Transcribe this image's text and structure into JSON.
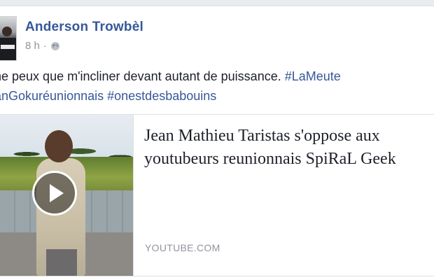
{
  "post": {
    "author": "Anderson Trowbèl",
    "time": "8 h",
    "separator": "·",
    "privacy_icon": "globe-icon",
    "text_line1_plain": "ne peux que m'incliner devant autant de puissance. ",
    "text_line1_tag": "#LaMeute",
    "text_line2_tag1": "anGokuréunionnais",
    "text_line2_tag2": "#onestdesbabouins"
  },
  "link_preview": {
    "title_line1": "Jean Mathieu Taristas s'oppose aux",
    "title_line2": "youtubeurs reunionnais SpiRaL Geek",
    "domain": "YOUTUBE.COM",
    "play_icon": "play-icon"
  },
  "colors": {
    "link_blue": "#365899",
    "meta_gray": "#90949c",
    "text": "#1d2129"
  }
}
